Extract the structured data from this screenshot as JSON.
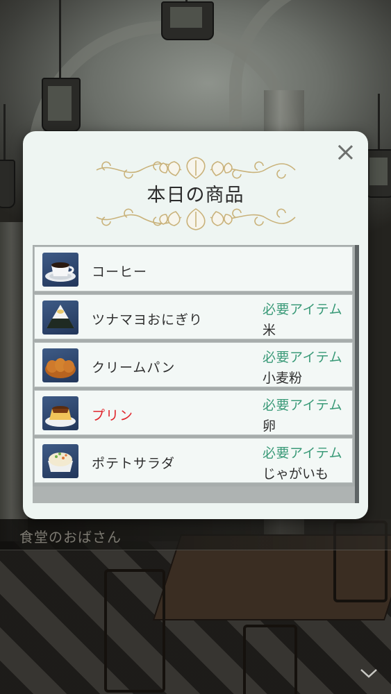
{
  "dialog": {
    "title": "本日の商品",
    "items": [
      {
        "name": "コーヒー",
        "icon": "coffee-icon",
        "highlight": false,
        "required_label": "",
        "required_item": ""
      },
      {
        "name": "ツナマヨおにぎり",
        "icon": "onigiri-icon",
        "highlight": false,
        "required_label": "必要アイテム",
        "required_item": "米"
      },
      {
        "name": "クリームパン",
        "icon": "cream-bread-icon",
        "highlight": false,
        "required_label": "必要アイテム",
        "required_item": "小麦粉"
      },
      {
        "name": "プリン",
        "icon": "pudding-icon",
        "highlight": true,
        "required_label": "必要アイテム",
        "required_item": "卵"
      },
      {
        "name": "ポテトサラダ",
        "icon": "potato-salad-icon",
        "highlight": false,
        "required_label": "必要アイテム",
        "required_item": "じゃがいも"
      }
    ]
  },
  "namebar": {
    "speaker": "食堂のおばさん"
  },
  "colors": {
    "required_label": "#3a9a78",
    "highlight_name": "#e0262c",
    "dialog_bg": "#eef5f2"
  },
  "icons": {
    "close": "close-icon",
    "advance": "chevron-down-icon",
    "ornament": "leaf-vine-ornament"
  }
}
